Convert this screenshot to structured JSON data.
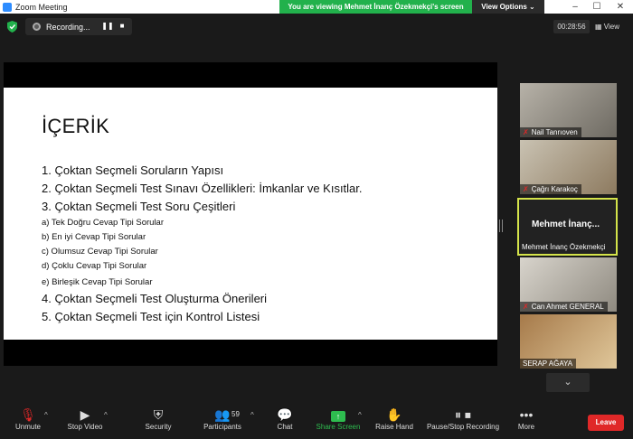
{
  "window": {
    "app_title": "Zoom Meeting"
  },
  "banner": {
    "viewing_text": "You are viewing Mehmet İnanç Özekmekçi's screen",
    "view_options_label": "View Options ⌄"
  },
  "top": {
    "recording_label": "Recording...",
    "timer": "00:28:56",
    "view_label": "View"
  },
  "slide": {
    "title": "İÇERİK",
    "items": [
      {
        "text": "1. Çoktan Seçmeli Soruların Yapısı",
        "size": "big"
      },
      {
        "text": "2. Çoktan Seçmeli Test Sınavı Özellikleri: İmkanlar ve Kısıtlar.",
        "size": "big"
      },
      {
        "text": "3. Çoktan Seçmeli Test Soru Çeşitleri",
        "size": "big"
      },
      {
        "text": "a) Tek Doğru Cevap Tipi Sorular",
        "size": "small"
      },
      {
        "text": "b) En iyi Cevap Tipi Sorular",
        "size": "small"
      },
      {
        "text": "c) Olumsuz Cevap Tipi Sorular",
        "size": "small"
      },
      {
        "text": "d) Çoklu Cevap Tipi Sorular",
        "size": "small"
      },
      {
        "text": "e) Birleşik Cevap Tipi Sorular",
        "size": "small"
      },
      {
        "text": "4. Çoktan Seçmeli Test Oluşturma Önerileri",
        "size": "big"
      },
      {
        "text": "5. Çoktan Seçmeli Test için Kontrol Listesi",
        "size": "big"
      }
    ]
  },
  "participants": [
    {
      "name": "Nail Tanrıoven",
      "muted": true
    },
    {
      "name": "Çağrı Karakoç",
      "muted": true
    },
    {
      "name": "Mehmet İnanç Özekmekçi",
      "short": "Mehmet İnanç...",
      "muted": false,
      "active": true
    },
    {
      "name": "Can Ahmet GENERAL",
      "muted": true
    },
    {
      "name": "SERAP AĞAYA",
      "muted": false
    }
  ],
  "toolbar": {
    "unmute": "Unmute",
    "stop_video": "Stop Video",
    "security": "Security",
    "participants": "Participants",
    "participants_count": "59",
    "chat": "Chat",
    "share_screen": "Share Screen",
    "raise_hand": "Raise Hand",
    "pause_recording": "Pause/Stop Recording",
    "more": "More",
    "leave": "Leave"
  },
  "colors": {
    "share_green": "#2ebc4f",
    "leave_red": "#e02828",
    "banner_green": "#22b14c",
    "active_border": "#d4e34a"
  },
  "icons": [
    "shield-icon",
    "record-icon",
    "pause-icon",
    "stop-icon",
    "mic-muted-icon",
    "video-icon",
    "security-icon",
    "participants-icon",
    "chat-icon",
    "share-icon",
    "hand-icon",
    "pause-recording-icon",
    "more-icon",
    "chevron-down-icon"
  ]
}
